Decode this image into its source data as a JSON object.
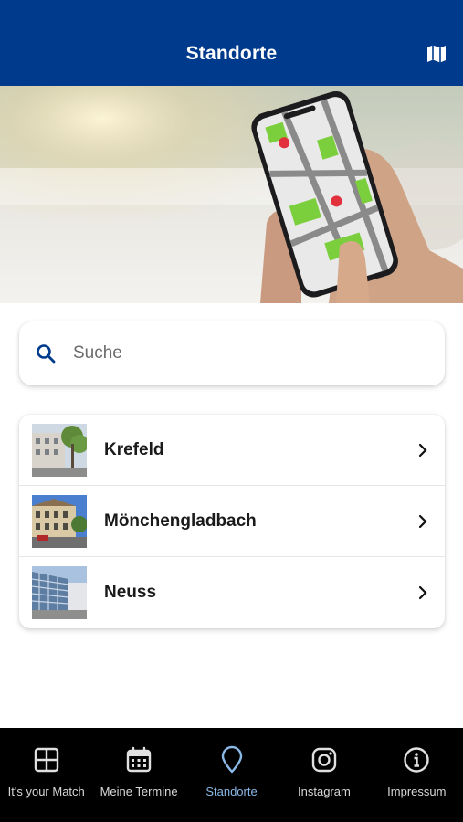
{
  "header": {
    "title": "Standorte",
    "map_icon": "map-icon"
  },
  "hero": {
    "description_icon": "phone-map-illustration"
  },
  "search": {
    "placeholder": "Suche",
    "value": "",
    "icon": "search-icon"
  },
  "locations": [
    {
      "label": "Krefeld",
      "icon": "chevron-right-icon"
    },
    {
      "label": "Mönchengladbach",
      "icon": "chevron-right-icon"
    },
    {
      "label": "Neuss",
      "icon": "chevron-right-icon"
    }
  ],
  "nav": {
    "items": [
      {
        "label": "It's your Match",
        "icon": "grid-icon",
        "active": false
      },
      {
        "label": "Meine Termine",
        "icon": "calendar-icon",
        "active": false
      },
      {
        "label": "Standorte",
        "icon": "location-pin-icon",
        "active": true
      },
      {
        "label": "Instagram",
        "icon": "instagram-icon",
        "active": false
      },
      {
        "label": "Impressum",
        "icon": "info-icon",
        "active": false
      }
    ]
  },
  "colors": {
    "primary": "#003a8c",
    "nav_background": "#000000",
    "nav_active": "#8ab8e6",
    "map_green": "#7ccf3c",
    "pin_red": "#e0313d"
  }
}
